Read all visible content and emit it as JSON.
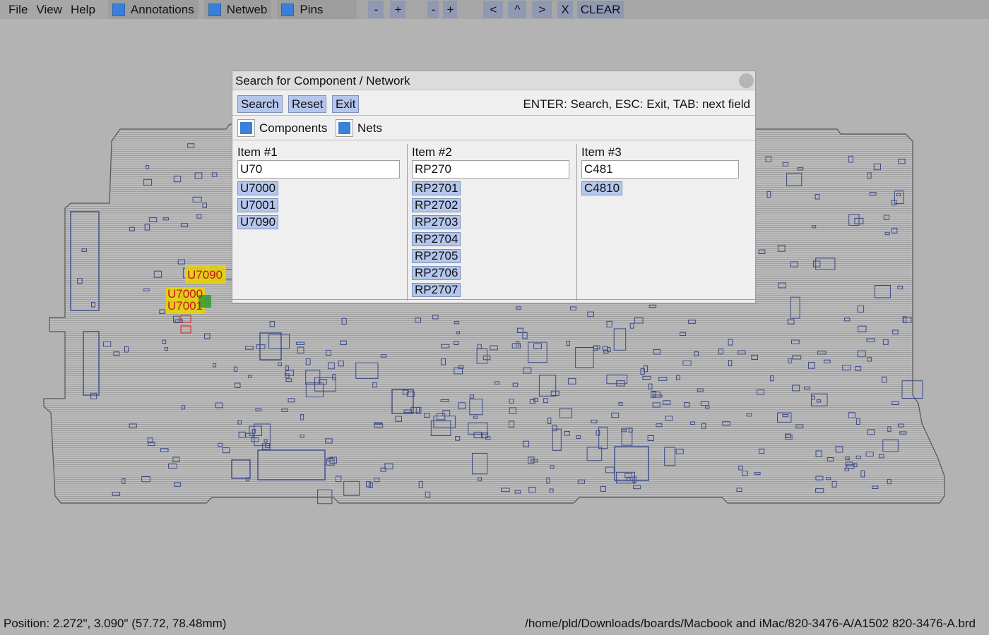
{
  "menu": {
    "file": "File",
    "view": "View",
    "help": "Help"
  },
  "toggles": {
    "annotations": "Annotations",
    "netweb": "Netweb",
    "pins": "Pins"
  },
  "toolbar": {
    "zoom_out": "-",
    "zoom_in": "+",
    "rot_minus": "-",
    "rot_plus": "+",
    "prev": "<",
    "up": "^",
    "next": ">",
    "close": "X",
    "clear": "CLEAR"
  },
  "dialog": {
    "title": "Search for Component / Network",
    "search_label": "Search",
    "reset_label": "Reset",
    "exit_label": "Exit",
    "hint": "ENTER: Search, ESC: Exit, TAB: next field",
    "components_label": "Components",
    "nets_label": "Nets",
    "columns": [
      {
        "label": "Item #1",
        "value": "U70",
        "results": [
          "U7000",
          "U7001",
          "U7090"
        ]
      },
      {
        "label": "Item #2",
        "value": "RP270",
        "results": [
          "RP2701",
          "RP2702",
          "RP2703",
          "RP2704",
          "RP2705",
          "RP2706",
          "RP2707"
        ]
      },
      {
        "label": "Item #3",
        "value": "C481",
        "results": [
          "C4810"
        ]
      }
    ]
  },
  "board_labels": {
    "u7090": "U7090",
    "u7000": "U7000",
    "u7001": "U7001"
  },
  "status": {
    "position": "Position: 2.272\", 3.090\" (57.72, 78.48mm)",
    "path": "/home/pld/Downloads/boards/Macbook and iMac/820-3476-A/A1502 820-3476-A.brd"
  },
  "colors": {
    "accent": "#3a7fd9",
    "highlight": "#e5d200",
    "button": "#b4c6ec"
  }
}
